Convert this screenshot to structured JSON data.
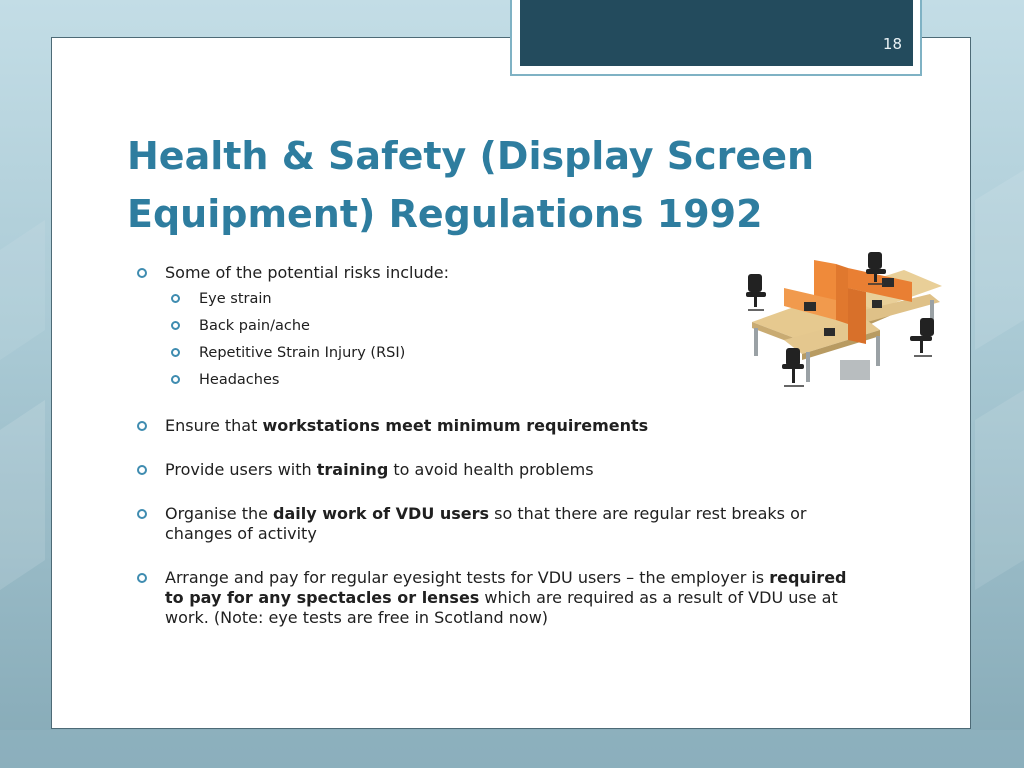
{
  "slide": {
    "number": "18",
    "title_line1": "Health & Safety (Display Screen",
    "title_line2": "Equipment) Regulations 1992"
  },
  "bullets": {
    "intro": "Some of the potential risks include:",
    "risks": [
      "Eye strain",
      "Back pain/ache",
      "Repetitive Strain Injury (RSI)",
      "Headaches"
    ],
    "b2_pre": "Ensure that ",
    "b2_bold": "workstations meet minimum requirements",
    "b3_pre": "Provide users with ",
    "b3_bold": "training",
    "b3_post": " to avoid health problems",
    "b4_pre": "Organise the ",
    "b4_bold": "daily work of VDU users",
    "b4_post": " so that there are regular rest breaks or changes of activity",
    "b5_pre": "Arrange and pay for regular eyesight tests for VDU users – the employer is ",
    "b5_bold": "required to pay for any spectacles or lenses",
    "b5_post": " which are required as a result of VDU use at work. (Note: eye tests are free in Scotland now)"
  },
  "image": {
    "subject": "office-workstations-photo"
  },
  "colors": {
    "title": "#2e7d9f",
    "bullet": "#3f8cb0",
    "header_bar": "#234b5d"
  }
}
